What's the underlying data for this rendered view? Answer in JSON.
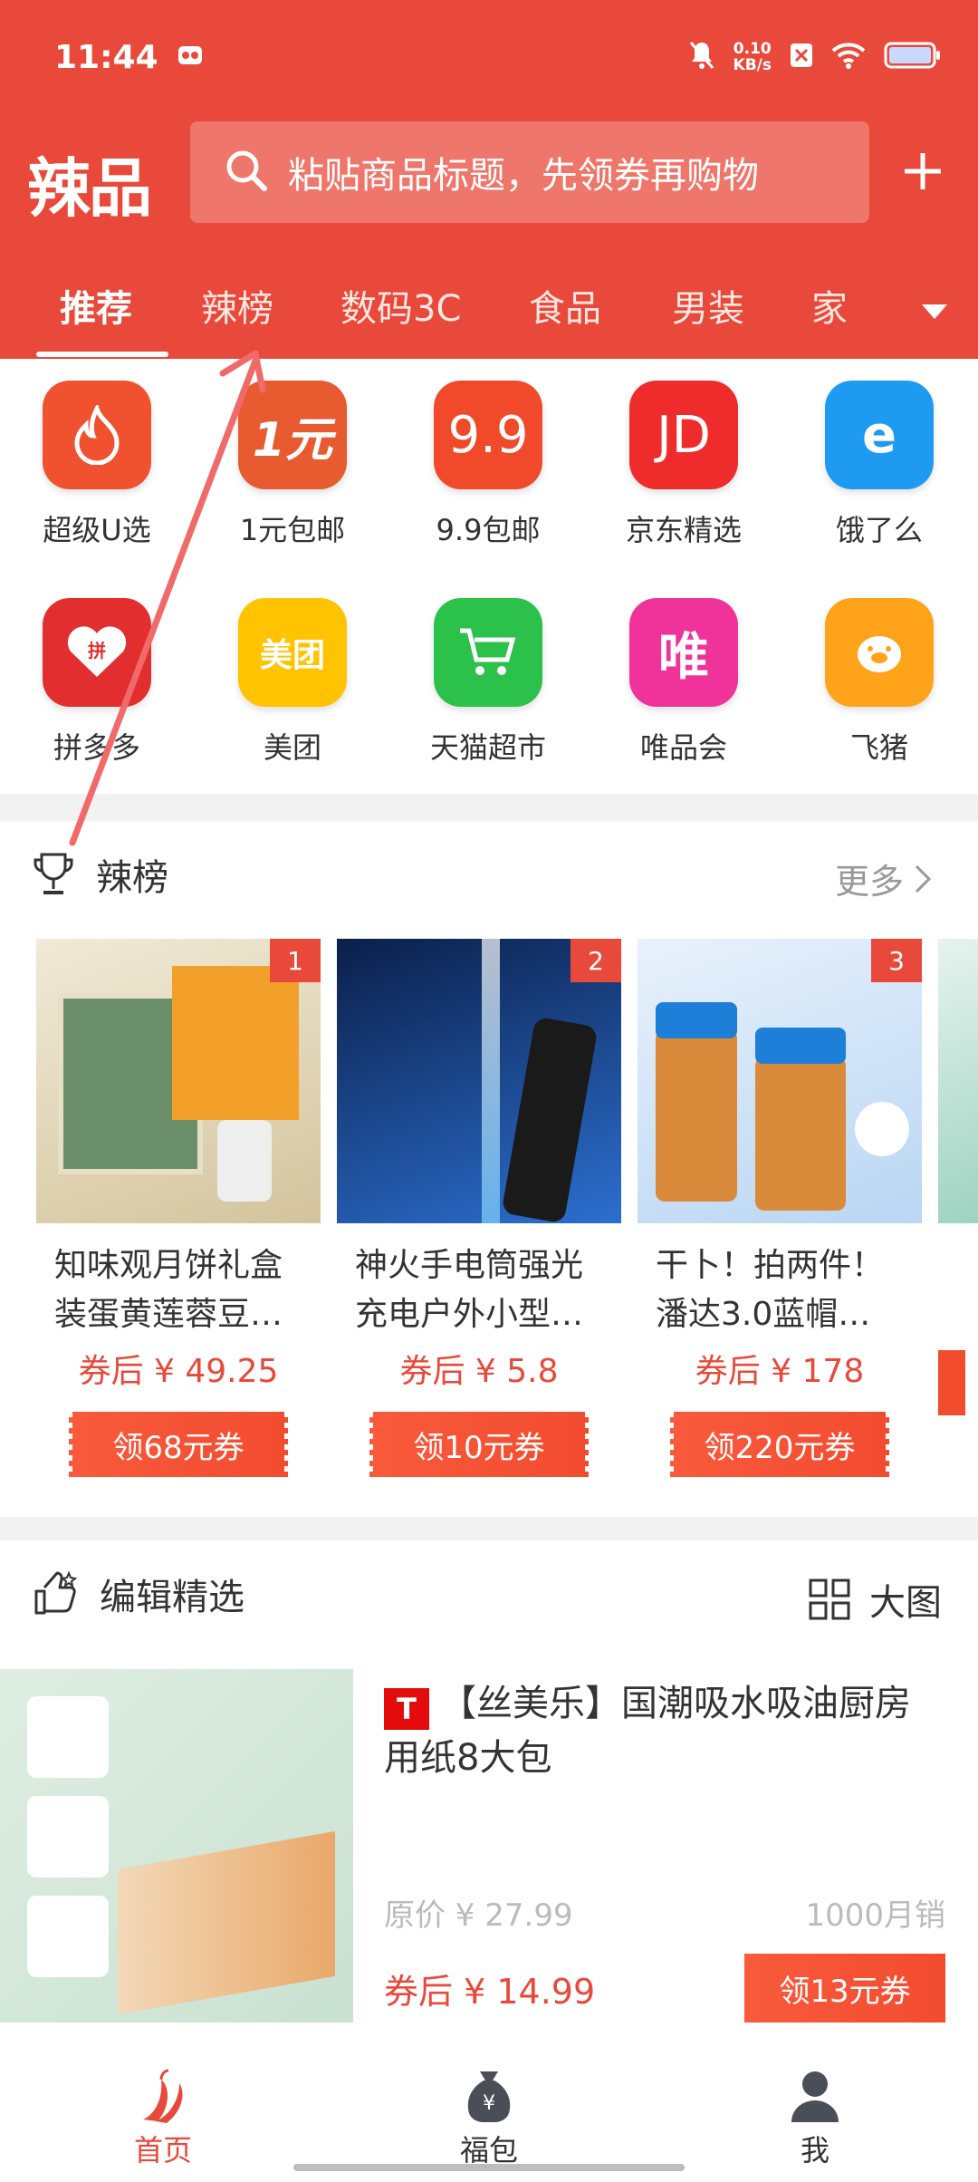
{
  "status": {
    "time": "11:44",
    "speed_value": "0.10",
    "speed_unit": "KB/s"
  },
  "header": {
    "logo": "辣品",
    "search_placeholder": "粘贴商品标题，先领券再购物",
    "tabs": [
      "推荐",
      "辣榜",
      "数码3C",
      "食品",
      "男装",
      "家"
    ]
  },
  "quick_links": [
    {
      "label": "超级U选",
      "icon": "flame-icon",
      "color": "#f0522f",
      "glyph": ""
    },
    {
      "label": "1元包邮",
      "icon": "one-yuan-icon",
      "color": "#e85a30",
      "glyph": "1元"
    },
    {
      "label": "9.9包邮",
      "icon": "nine-nine-icon",
      "color": "#f04a2a",
      "glyph": "9.9"
    },
    {
      "label": "京东精选",
      "icon": "jd-icon",
      "color": "#ee2c2c",
      "glyph": "JD"
    },
    {
      "label": "饿了么",
      "icon": "eleme-icon",
      "color": "#1e9bf0",
      "glyph": "e"
    },
    {
      "label": "拼多多",
      "icon": "pinduoduo-icon",
      "color": "#e22e2e",
      "glyph": "拼"
    },
    {
      "label": "美团",
      "icon": "meituan-icon",
      "color": "#ffc300",
      "glyph": "美团"
    },
    {
      "label": "天猫超市",
      "icon": "tmall-supermarket-icon",
      "color": "#2bc14a",
      "glyph": "🛒"
    },
    {
      "label": "唯品会",
      "icon": "vipshop-icon",
      "color": "#f0339a",
      "glyph": "唯"
    },
    {
      "label": "飞猪",
      "icon": "fliggy-icon",
      "color": "#ffa31a",
      "glyph": "🐷"
    }
  ],
  "hot": {
    "title": "辣榜",
    "more": "更多",
    "items": [
      {
        "rank": "1",
        "name": "知味观月饼礼盒装蛋黄莲蓉豆…",
        "price": "券后 ¥ 49.25",
        "coupon": "领68元券"
      },
      {
        "rank": "2",
        "name": "神火手电筒强光充电户外小型…",
        "price": "券后 ¥ 5.8",
        "coupon": "领10元券"
      },
      {
        "rank": "3",
        "name": "干卜！拍两件！潘达3.0蓝帽…",
        "price": "券后 ¥ 178",
        "coupon": "领220元券"
      }
    ]
  },
  "picks": {
    "title": "编辑精选",
    "view_toggle": "大图",
    "item": {
      "title": "【丝美乐】国潮吸水吸油厨房用纸8大包",
      "orig_price": "原价 ¥ 27.99",
      "sales": "1000月销",
      "price": "券后 ¥ 14.99",
      "coupon": "领13元券"
    }
  },
  "bottom_nav": [
    {
      "label": "首页",
      "icon": "pepper-icon"
    },
    {
      "label": "福包",
      "icon": "money-bag-icon"
    },
    {
      "label": "我",
      "icon": "user-icon"
    }
  ],
  "colors": {
    "brand": "#e8493a",
    "accent": "#f24c2f"
  }
}
